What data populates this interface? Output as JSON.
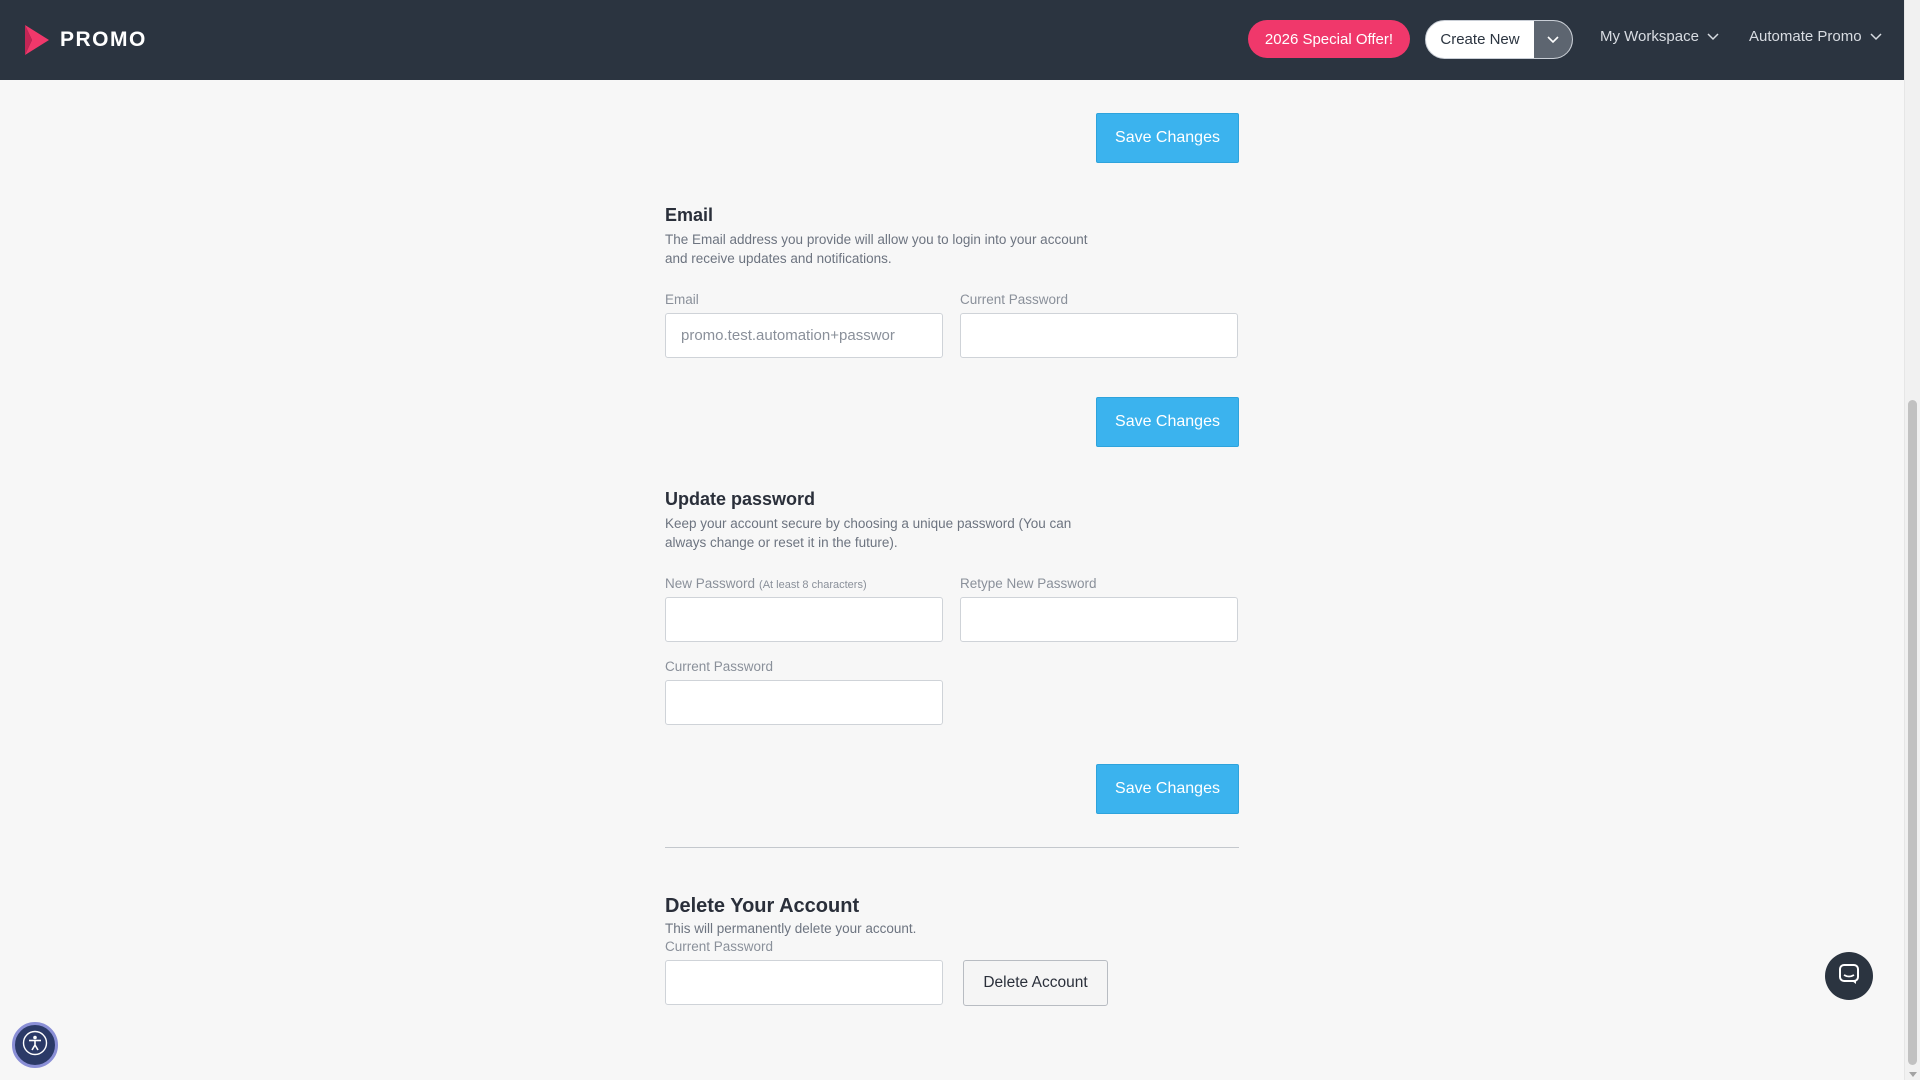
{
  "header": {
    "brand": "PROMO",
    "offer_label": "2026 Special Offer!",
    "create_label": "Create New",
    "workspace_label": "My Workspace",
    "account_label": "Automate Promo"
  },
  "top_section": {
    "save_label": "Save Changes"
  },
  "email_section": {
    "title": "Email",
    "description": "The Email address you provide will allow you to login into your account and receive updates and notifications.",
    "email_label": "Email",
    "email_value": "promo.test.automation+passwor",
    "current_password_label": "Current Password",
    "current_password_value": "",
    "save_label": "Save Changes"
  },
  "password_section": {
    "title": "Update password",
    "description": "Keep your account secure by choosing a unique password (You can always change or reset it in the future).",
    "new_password_label": "New Password",
    "new_password_hint": "(At least 8 characters)",
    "retype_label": "Retype New Password",
    "current_password_label": "Current Password",
    "save_label": "Save Changes"
  },
  "delete_section": {
    "title": "Delete Your Account",
    "description": "This will permanently delete your account.",
    "current_password_label": "Current Password",
    "delete_label": "Delete Account"
  },
  "colors": {
    "topbar": "#2b3440",
    "accent_pink": "#f0386b",
    "save_blue": "#3bb3ee",
    "background": "#f7f7f7"
  },
  "icons": {
    "logo": "play-logo-icon",
    "dropdown": "chevron-down-icon",
    "chat": "chat-icon",
    "accessibility": "accessibility-icon"
  }
}
